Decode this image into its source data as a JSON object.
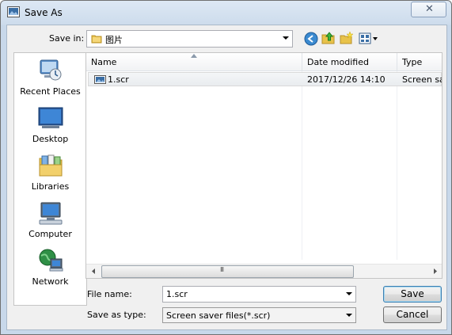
{
  "window": {
    "title": "Save As",
    "close_glyph": "✕"
  },
  "toolbar": {
    "save_in_label": "Save in:",
    "save_in_value": "图片",
    "icons": [
      "back-icon",
      "up-folder-icon",
      "new-folder-icon",
      "view-menu-icon"
    ]
  },
  "places": [
    {
      "label": "Recent Places",
      "icon": "recent-places-icon"
    },
    {
      "label": "Desktop",
      "icon": "desktop-icon"
    },
    {
      "label": "Libraries",
      "icon": "libraries-icon"
    },
    {
      "label": "Computer",
      "icon": "computer-icon"
    },
    {
      "label": "Network",
      "icon": "network-icon"
    }
  ],
  "filelist": {
    "columns": [
      "Name",
      "Date modified",
      "Type"
    ],
    "rows": [
      {
        "name": "1.scr",
        "date": "2017/12/26 14:10",
        "type": "Screen saver"
      }
    ],
    "scroll_grip": "III"
  },
  "form": {
    "filename_label": "File name:",
    "filename_value": "1.scr",
    "type_label": "Save as type:",
    "type_value": "Screen saver files(*.scr)"
  },
  "buttons": {
    "save": "Save",
    "cancel": "Cancel"
  }
}
